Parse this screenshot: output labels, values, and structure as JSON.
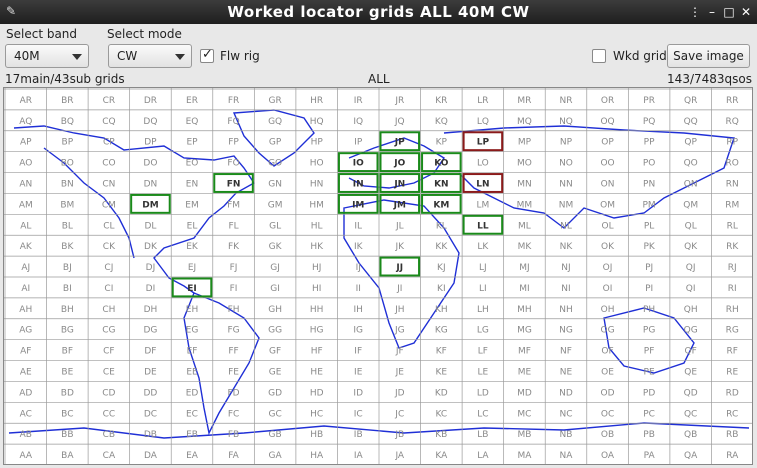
{
  "window": {
    "title": "Worked locator grids ALL 40M CW"
  },
  "controls": {
    "band_label": "Select band",
    "band_value": "40M",
    "mode_label": "Select mode",
    "mode_value": "CW",
    "flw_rig_label": "Flw rig",
    "flw_rig_checked": true,
    "wkd_grid_label": "Wkd grid",
    "wkd_grid_checked": false,
    "save_button": "Save image"
  },
  "status": {
    "left": "17main/43sub grids",
    "center": "ALL",
    "right": "143/7483qsos"
  },
  "grid": {
    "columns": [
      "A",
      "B",
      "C",
      "D",
      "E",
      "F",
      "G",
      "H",
      "I",
      "J",
      "K",
      "L",
      "M",
      "N",
      "O",
      "P",
      "Q",
      "R"
    ],
    "rows": [
      "R",
      "Q",
      "P",
      "O",
      "N",
      "M",
      "L",
      "K",
      "J",
      "I",
      "H",
      "G",
      "F",
      "E",
      "D",
      "C",
      "B",
      "A"
    ],
    "worked_green": [
      "JP",
      "IO",
      "JO",
      "KO",
      "FN",
      "IN",
      "JN",
      "KN",
      "DM",
      "IM",
      "JM",
      "KM",
      "LL",
      "JJ",
      "EI"
    ],
    "worked_red": [
      "LP",
      "LN"
    ]
  },
  "colors": {
    "worked_green": "#1a8a1a",
    "worked_red": "#8a1a1a",
    "coast": "#1f2fd6",
    "grid_line": "#9a9a9a"
  }
}
